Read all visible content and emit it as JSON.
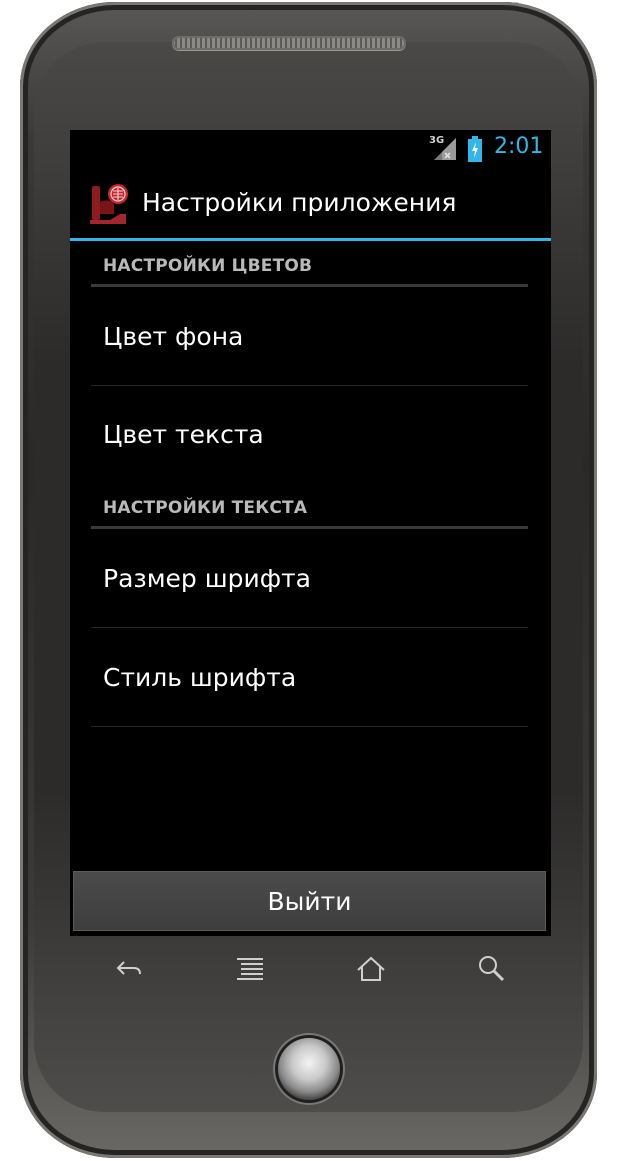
{
  "status_bar": {
    "network": "3G",
    "clock": "2:01",
    "accent_color": "#33b5e5"
  },
  "action_bar": {
    "title": "Настройки приложения",
    "icon": "app-logo-icon"
  },
  "sections": [
    {
      "header": "НАСТРОЙКИ ЦВЕТОВ",
      "items": [
        "Цвет фона",
        "Цвет текста"
      ]
    },
    {
      "header": "НАСТРОЙКИ ТЕКСТА",
      "items": [
        "Размер шрифта",
        "Стиль шрифта"
      ]
    }
  ],
  "exit_button": {
    "label": "Выйти"
  },
  "nav_bar": {
    "buttons": [
      "back-icon",
      "menu-icon",
      "home-icon",
      "search-icon"
    ]
  }
}
